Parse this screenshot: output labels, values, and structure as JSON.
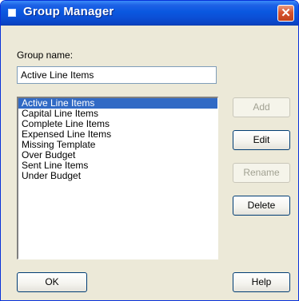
{
  "window": {
    "title": "Group Manager"
  },
  "group_name": {
    "label": "Group name:",
    "value": "Active Line Items"
  },
  "groups": [
    "Active Line Items",
    "Capital Line Items",
    "Complete Line Items",
    "Expensed Line Items",
    "Missing Template",
    "Over Budget",
    "Sent Line Items",
    "Under Budget"
  ],
  "selected_group_index": 0,
  "buttons": {
    "add": "Add",
    "edit": "Edit",
    "rename": "Rename",
    "delete": "Delete",
    "ok": "OK",
    "help": "Help"
  },
  "button_states": {
    "add": "disabled",
    "edit": "enabled",
    "rename": "disabled",
    "delete": "enabled",
    "ok": "enabled",
    "help": "enabled"
  },
  "icons": {
    "title": "window-icon",
    "close": "close-icon"
  },
  "colors": {
    "titlebar": "#0a58e0",
    "selection": "#316ac5",
    "close": "#d7532f",
    "dialog_bg": "#ece9d8"
  }
}
